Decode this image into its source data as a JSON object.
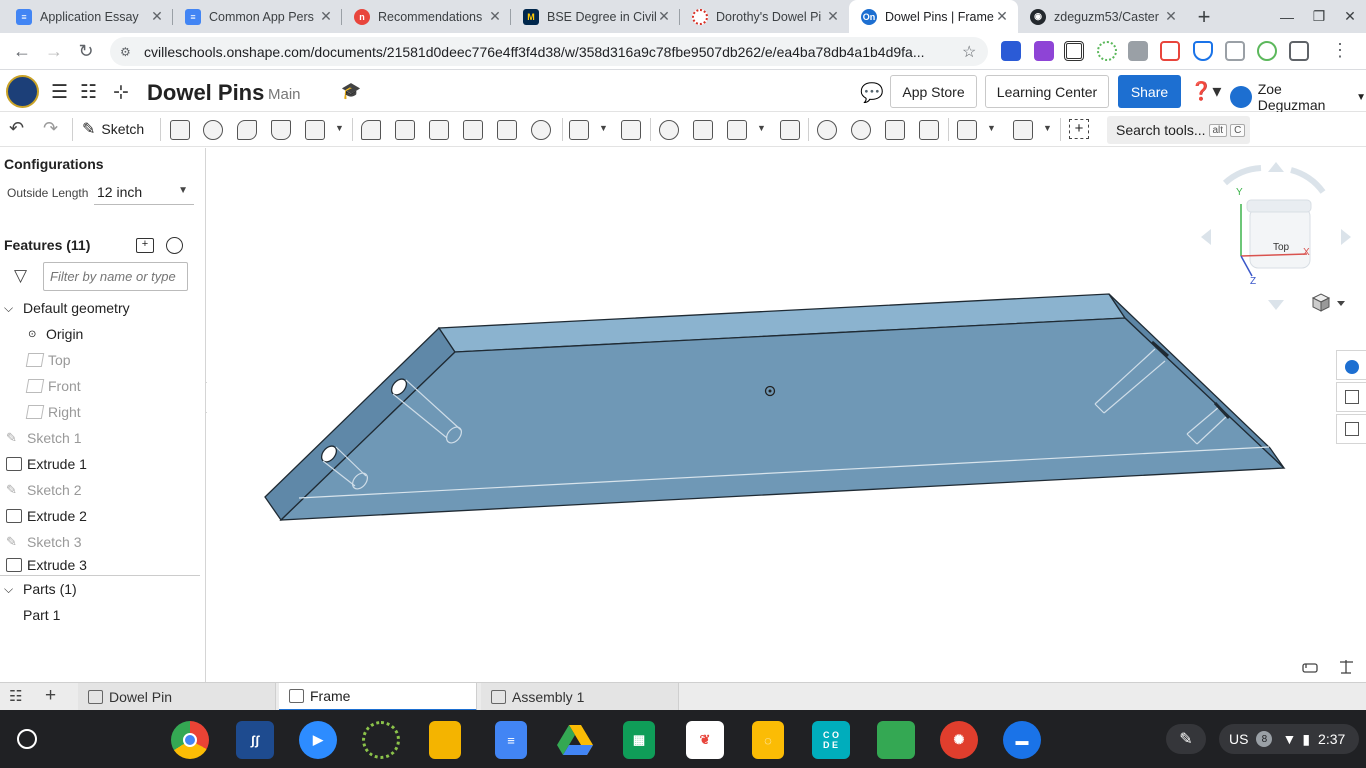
{
  "browser": {
    "tabs": [
      {
        "title": "Application Essay",
        "color": "#4285f4"
      },
      {
        "title": "Common App Pers",
        "color": "#4285f4"
      },
      {
        "title": "Recommendations",
        "color": "#e8453c"
      },
      {
        "title": "BSE Degree in Civil",
        "color": "#00274c"
      },
      {
        "title": "Dorothy's Dowel Pi",
        "color": "#d93025"
      },
      {
        "title": "Dowel Pins | Frame",
        "color": "#1d6fd1"
      },
      {
        "title": "zdeguzm53/Caster",
        "color": "#24292e"
      }
    ],
    "url": "cvilleschools.onshape.com/documents/21581d0deec776e4ff3f4d38/w/358d316a9c78fbe9507db262/e/ea4ba78db4a1b4d9fa..."
  },
  "header": {
    "doc_title": "Dowel Pins",
    "branch": "Main",
    "app_store": "App Store",
    "learning_center": "Learning Center",
    "share": "Share",
    "user": "Zoe Deguzman"
  },
  "toolbar": {
    "sketch_label": "Sketch",
    "search_label": "Search tools...",
    "shortcut_alt": "alt",
    "shortcut_key": "C"
  },
  "config": {
    "title": "Configurations",
    "label": "Outside Length",
    "value": "12 inch"
  },
  "features": {
    "title": "Features (11)",
    "filter_placeholder": "Filter by name or type",
    "default_geometry": "Default geometry",
    "items": [
      {
        "label": "Origin"
      },
      {
        "label": "Top"
      },
      {
        "label": "Front"
      },
      {
        "label": "Right"
      },
      {
        "label": "Sketch 1"
      },
      {
        "label": "Extrude 1"
      },
      {
        "label": "Sketch 2"
      },
      {
        "label": "Extrude 2"
      },
      {
        "label": "Sketch 3"
      },
      {
        "label": "Extrude 3"
      }
    ]
  },
  "parts": {
    "title": "Parts (1)",
    "items": [
      {
        "label": "Part 1"
      }
    ]
  },
  "viewcube": {
    "face": "Top",
    "axis_x": "X",
    "axis_y": "Y",
    "axis_z": "Z"
  },
  "bottom_tabs": [
    {
      "label": "Dowel Pin"
    },
    {
      "label": "Frame"
    },
    {
      "label": "Assembly 1"
    }
  ],
  "system": {
    "locale": "US",
    "badge": "8",
    "time": "2:37"
  },
  "colors": {
    "accent": "#1d6fd1",
    "part_fill": "#6f98b6",
    "part_top": "#8bb3cf"
  }
}
